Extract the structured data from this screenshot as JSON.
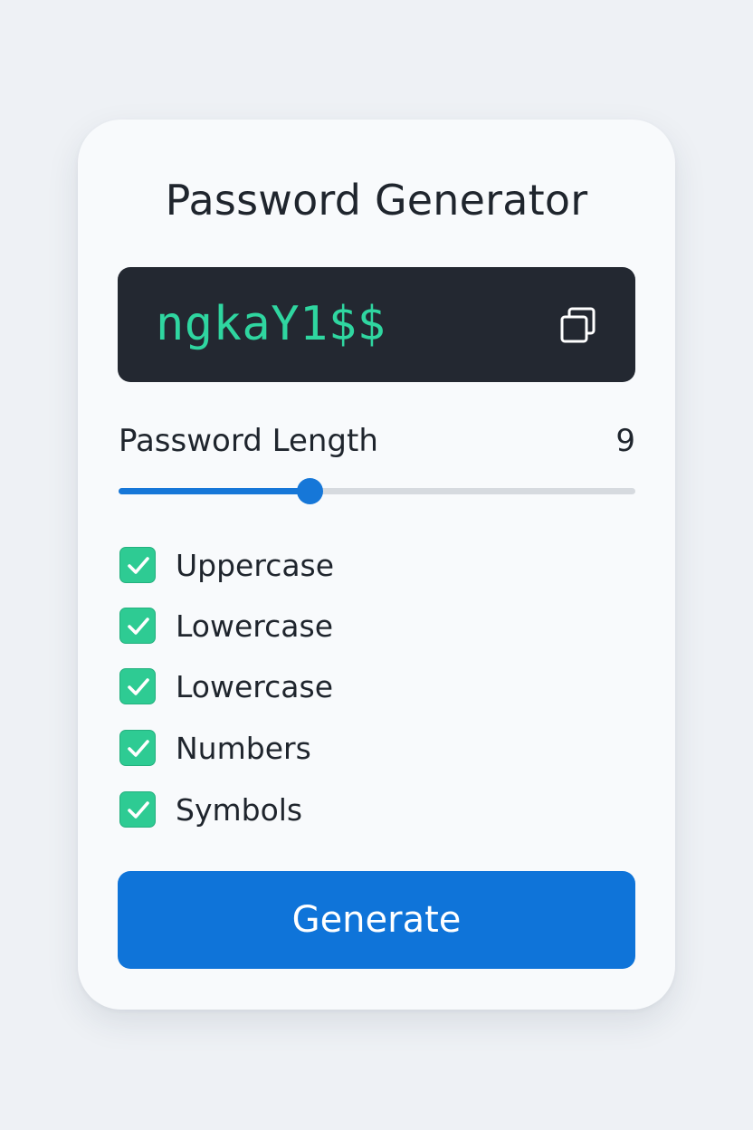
{
  "title": "Password Generator",
  "password": "ngkaY1$$",
  "length": {
    "label": "Password Length",
    "value": "9",
    "slider_fraction": 0.37
  },
  "options": [
    {
      "label": "Uppercase",
      "checked": true
    },
    {
      "label": "Lowercase",
      "checked": true
    },
    {
      "label": "Lowercase",
      "checked": true
    },
    {
      "label": "Numbers",
      "checked": true
    },
    {
      "label": "Symbols",
      "checked": true
    }
  ],
  "generate_label": "Generate",
  "icons": {
    "copy": "copy-icon",
    "check": "checkmark-icon"
  },
  "colors": {
    "background": "#eef1f5",
    "card": "#f8fafc",
    "display_bg": "#232831",
    "password_text": "#2fd6a0",
    "accent": "#0f74d9",
    "checkbox": "#2ecb93"
  }
}
